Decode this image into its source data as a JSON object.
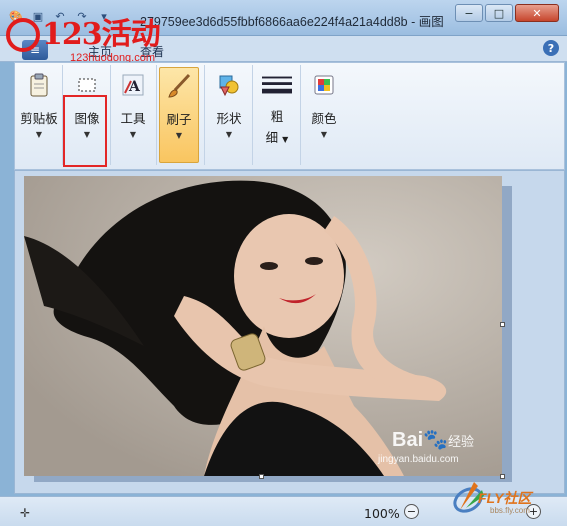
{
  "titlebar": {
    "title": "279759ee3d6d55fbbf6866aa6e224f4a21a4dd8b - 画图",
    "minimize": "−",
    "maximize": "□",
    "close": "✕"
  },
  "watermark": {
    "logo_text": "123活动",
    "logo_url": "123huodong.com"
  },
  "tabs": {
    "home": "主页",
    "view": "查看"
  },
  "ribbon": {
    "clipboard": "剪贴板",
    "image": "图像",
    "tools": "工具",
    "brushes": "刷子",
    "shapes": "形状",
    "size_line1": "粗",
    "size_line2": "细",
    "colors": "颜色"
  },
  "canvas": {
    "baidu_logo": "Bai",
    "baidu_logo_suffix": "经验",
    "baidu_url": "jingyan.baidu.com"
  },
  "status": {
    "zoom": "100%"
  },
  "fly_watermark": {
    "text": "FLY社区",
    "sub": "bbs.fly.com"
  },
  "colors": {
    "highlight": "#e32626",
    "selected_tool": "#f9c560"
  }
}
